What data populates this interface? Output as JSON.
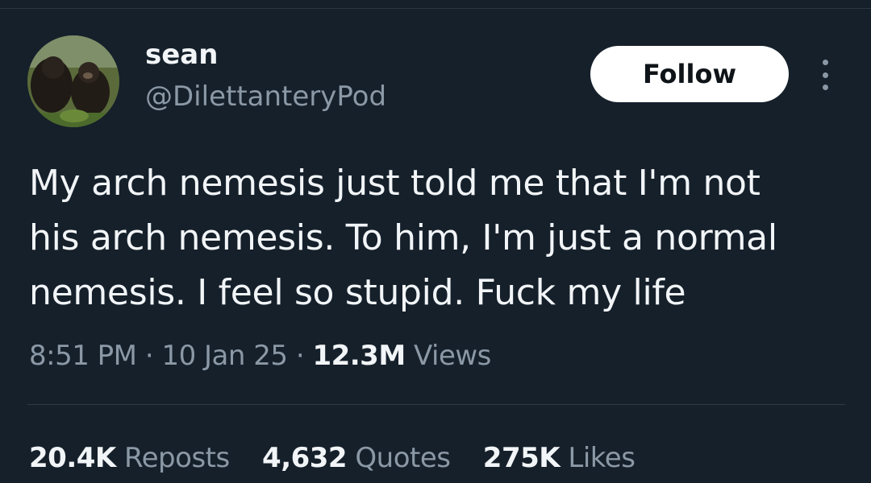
{
  "tweet": {
    "author": {
      "display_name": "sean",
      "handle": "@DilettanteryPod"
    },
    "follow_label": "Follow",
    "more_icon": "more-vertical-icon",
    "text_lines": [
      "My arch nemesis just told me that I'm not",
      "his arch nemesis. To him, I'm just a normal",
      "nemesis. I feel so stupid. Fuck my life"
    ],
    "time": "8:51 PM",
    "date": "10 Jan 25",
    "separator": "·",
    "views_count": "12.3M",
    "views_label": "Views",
    "stats": {
      "reposts_count": "20.4K",
      "reposts_label": "Reposts",
      "quotes_count": "4,632",
      "quotes_label": "Quotes",
      "likes_count": "275K",
      "likes_label": "Likes"
    }
  },
  "colors": {
    "background": "#15202b",
    "primary_text": "#f2f5f7",
    "secondary_text": "#8b98a5",
    "follow_button_bg": "#ffffff"
  }
}
